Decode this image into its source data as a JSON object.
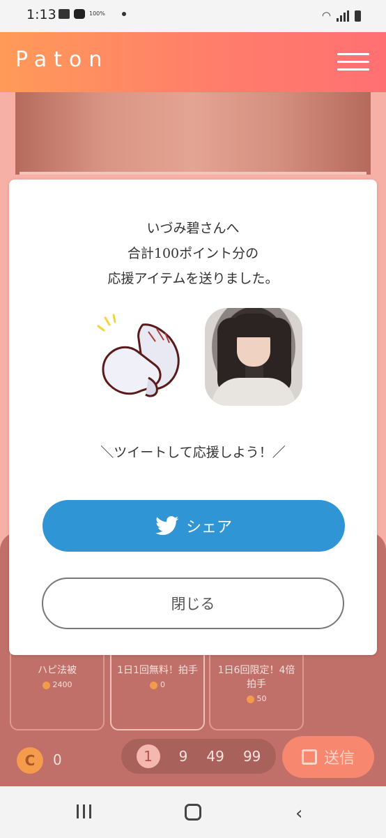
{
  "status_bar": {
    "time": "1:13",
    "battery_label": "100%"
  },
  "header": {
    "logo": "Paton"
  },
  "modal": {
    "message_line1": "いづみ碧さんへ",
    "message_line2": "合計100ポイント分の",
    "message_line3": "応援アイテムを送りました。",
    "tweet_prompt": "＼ツイートして応援しよう！／",
    "share_label": "シェア",
    "close_label": "閉じる"
  },
  "items": [
    {
      "name": "ハピ法被",
      "price": "2400"
    },
    {
      "name": "1日1回無料！拍手",
      "price": "0"
    },
    {
      "name": "1日6回限定！4倍拍手",
      "price": "50"
    }
  ],
  "bottom_bar": {
    "coin_symbol": "C",
    "coin_balance": "0",
    "quantities": [
      "1",
      "9",
      "49",
      "99"
    ],
    "selected_quantity": "1",
    "send_label": "送信"
  },
  "colors": {
    "header_gradient_start": "#ff9a58",
    "header_gradient_end": "#ff7072",
    "twitter_blue": "#2f95d4"
  }
}
